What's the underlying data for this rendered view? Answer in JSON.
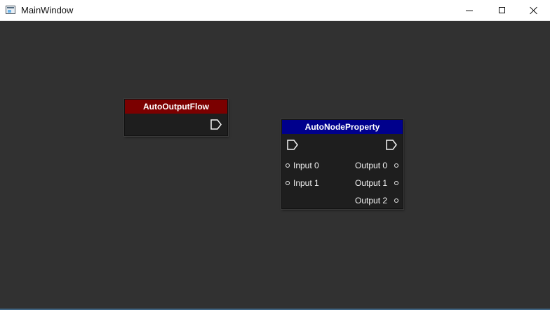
{
  "window": {
    "title": "MainWindow",
    "controls": {
      "minimize": "minimize",
      "maximize": "maximize",
      "close": "close"
    }
  },
  "nodes": [
    {
      "title": "AutoOutputFlow",
      "header_color": "#7b0000",
      "flow_outputs": [
        "flow-output-icon"
      ]
    },
    {
      "title": "AutoNodeProperty",
      "header_color": "#00008c",
      "flow_input": "flow-input-icon",
      "flow_output": "flow-output-icon",
      "inputs": [
        {
          "label": "Input 0"
        },
        {
          "label": "Input 1"
        }
      ],
      "outputs": [
        {
          "label": "Output 0"
        },
        {
          "label": "Output 1"
        },
        {
          "label": "Output 2"
        }
      ]
    }
  ],
  "icons": {
    "app": "window-app-icon",
    "minimize": "minimize-icon",
    "maximize": "maximize-icon",
    "close": "close-icon",
    "port": "port-dot-icon"
  },
  "colors": {
    "canvas": "#313131",
    "node_body": "#1e1e1e",
    "auto_output_header": "#7b0000",
    "auto_property_header": "#00008c",
    "text": "#ffffff"
  }
}
